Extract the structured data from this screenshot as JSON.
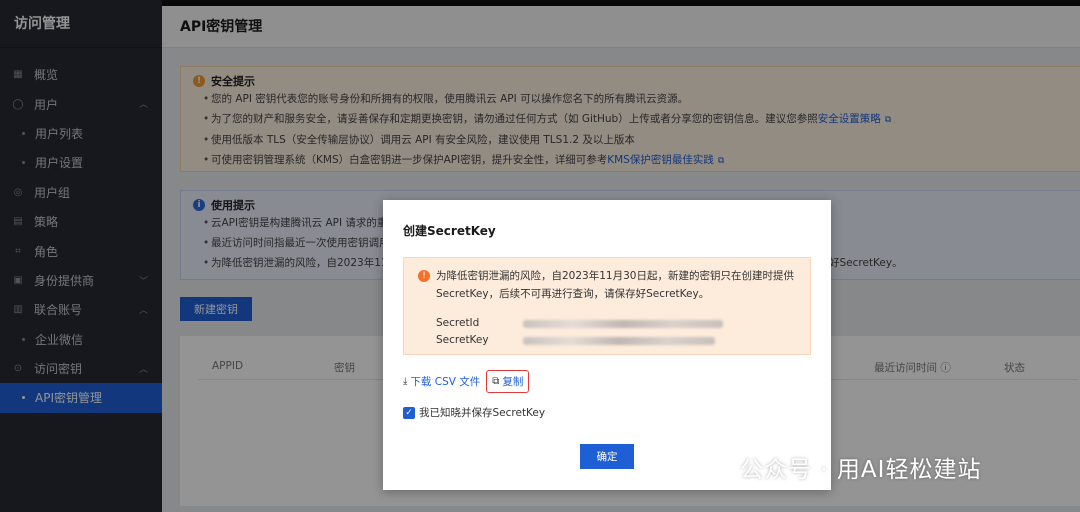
{
  "sidebar": {
    "title": "访问管理",
    "items": [
      {
        "label": "概览",
        "icon": "overview-icon",
        "level": 1
      },
      {
        "label": "用户",
        "icon": "user-icon",
        "level": 1,
        "expanded": true
      },
      {
        "label": "用户列表",
        "level": 2
      },
      {
        "label": "用户设置",
        "level": 2
      },
      {
        "label": "用户组",
        "icon": "user-group-icon",
        "level": 1
      },
      {
        "label": "策略",
        "icon": "policy-icon",
        "level": 1
      },
      {
        "label": "角色",
        "icon": "role-icon",
        "level": 1
      },
      {
        "label": "身份提供商",
        "icon": "identity-provider-icon",
        "level": 1,
        "expanded": false
      },
      {
        "label": "联合账号",
        "icon": "federated-account-icon",
        "level": 1,
        "expanded": true
      },
      {
        "label": "企业微信",
        "level": 2
      },
      {
        "label": "访问密钥",
        "icon": "access-key-icon",
        "level": 1,
        "expanded": true
      },
      {
        "label": "API密钥管理",
        "level": 2,
        "active": true
      }
    ]
  },
  "page": {
    "title": "API密钥管理"
  },
  "security_notice": {
    "title": "安全提示",
    "items": [
      {
        "text": "您的 API 密钥代表您的账号身份和所拥有的权限，使用腾讯云 API 可以操作您名下的所有腾讯云资源。",
        "link": ""
      },
      {
        "text": "为了您的财产和服务安全，请妥善保存和定期更换密钥，请勿通过任何方式（如 GitHub）上传或者分享您的密钥信息。建议您参照",
        "link": "安全设置策略"
      },
      {
        "text": "使用低版本 TLS（安全传输层协议）调用云 API 有安全风险，建议使用 TLS1.2 及以上版本",
        "link": ""
      },
      {
        "text": "可使用密钥管理系统（KMS）白盒密钥进一步保护API密钥，提升安全性，详细可参考",
        "link": "KMS保护密钥最佳实践"
      }
    ]
  },
  "usage_notice": {
    "title": "使用提示",
    "items": [
      {
        "text": "云API密钥是构建腾讯云 API 请求的重"
      },
      {
        "text": "最近访问时间指最近一次使用密钥调用"
      },
      {
        "text": "为降低密钥泄漏的风险，自2023年11月",
        "tail": "好SecretKey。"
      }
    ]
  },
  "toolbar": {
    "new_key_label": "新建密钥"
  },
  "table": {
    "headers": {
      "appid": "APPID",
      "key": "密钥",
      "last_access": "最近访问时间",
      "status": "状态"
    }
  },
  "modal": {
    "title": "创建SecretKey",
    "alert_text": "为降低密钥泄漏的风险，自2023年11月30日起，新建的密钥只在创建时提供SecretKey，后续不可再进行查询，请保存好SecretKey。",
    "secret_id_label": "SecretId",
    "secret_key_label": "SecretKey",
    "download_label": "下载 CSV 文件",
    "copy_label": "复制",
    "checkbox_label": "我已知晓并保存SecretKey",
    "checkbox_checked": true,
    "confirm_label": "确定"
  },
  "watermark": {
    "text": "公众号 · 用AI轻松建站"
  },
  "colors": {
    "sidebar_bg": "#262a33",
    "accent": "#1f5fd6",
    "warn_bg": "#fdf1e2",
    "info_bg": "#eaf0fb",
    "copy_highlight": "#e53935"
  }
}
